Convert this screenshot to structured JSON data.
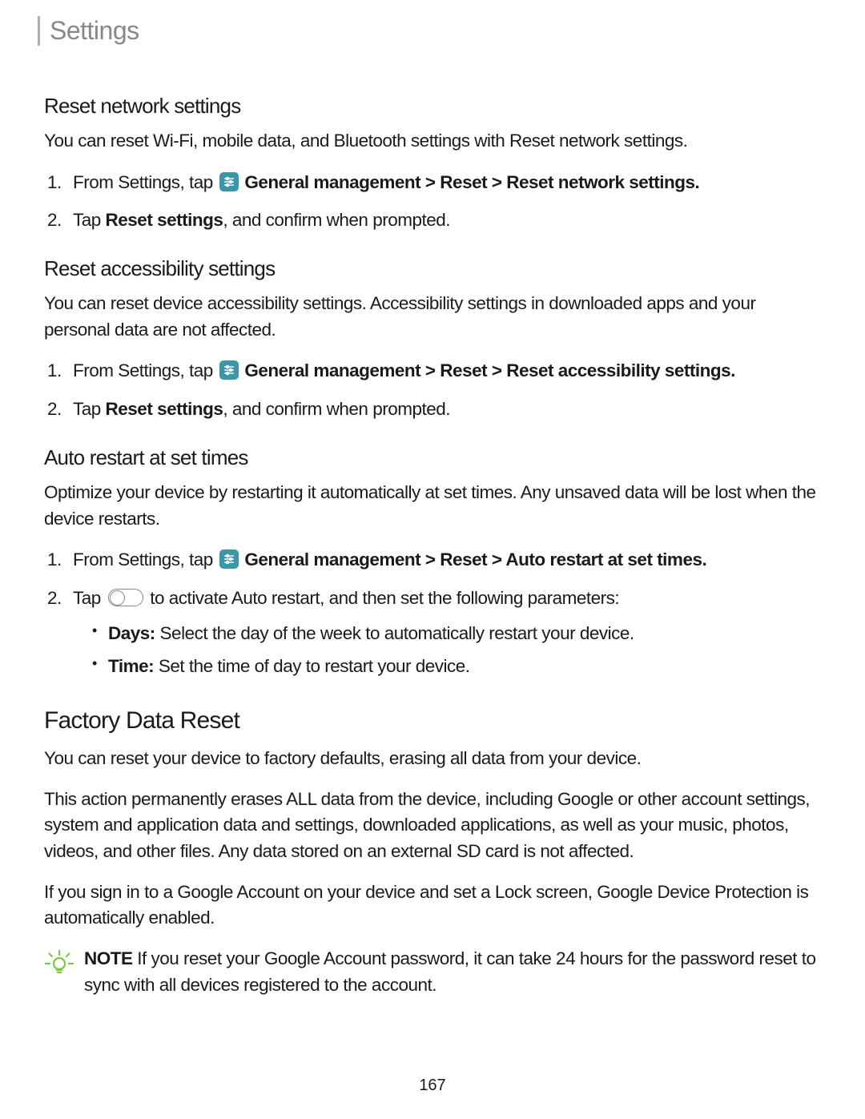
{
  "header": {
    "title": "Settings"
  },
  "sections": {
    "resetNetwork": {
      "heading": "Reset network settings",
      "intro": "You can reset Wi-Fi, mobile data, and Bluetooth settings with Reset network settings.",
      "step1_prefix": "From Settings, tap ",
      "step1_bold": " General management > Reset > Reset network settings.",
      "step2_prefix": "Tap ",
      "step2_bold": "Reset settings",
      "step2_suffix": ", and confirm when prompted."
    },
    "resetAccessibility": {
      "heading": "Reset accessibility settings",
      "intro": "You can reset device accessibility settings. Accessibility settings in downloaded apps and your personal data are not affected.",
      "step1_prefix": "From Settings, tap ",
      "step1_bold": " General management > Reset > Reset accessibility settings.",
      "step2_prefix": "Tap ",
      "step2_bold": "Reset settings",
      "step2_suffix": ", and confirm when prompted."
    },
    "autoRestart": {
      "heading": "Auto restart at set times",
      "intro": "Optimize your device by restarting it automatically at set times. Any unsaved data will be lost when the device restarts.",
      "step1_prefix": "From Settings, tap ",
      "step1_bold": " General management > Reset > Auto restart at set times.",
      "step2_prefix": "Tap ",
      "step2_suffix": " to activate Auto restart, and then set the following parameters:",
      "bullet1_bold": "Days:",
      "bullet1_text": " Select the day of the week to automatically restart your device.",
      "bullet2_bold": "Time:",
      "bullet2_text": " Set the time of day to restart your device."
    },
    "factoryReset": {
      "heading": "Factory Data Reset",
      "p1": "You can reset your device to factory defaults, erasing all data from your device.",
      "p2": "This action permanently erases ALL data from the device, including Google or other account settings, system and application data and settings, downloaded applications, as well as your music, photos, videos, and other files. Any data stored on an external SD card is not affected.",
      "p3": "If you sign in to a Google Account on your device and set a Lock screen, Google Device Protection is automatically enabled.",
      "note_label": "NOTE",
      "note_text": "  If you reset your Google Account password, it can take 24 hours for the password reset to sync with all devices registered to the account."
    }
  },
  "pageNumber": "167"
}
